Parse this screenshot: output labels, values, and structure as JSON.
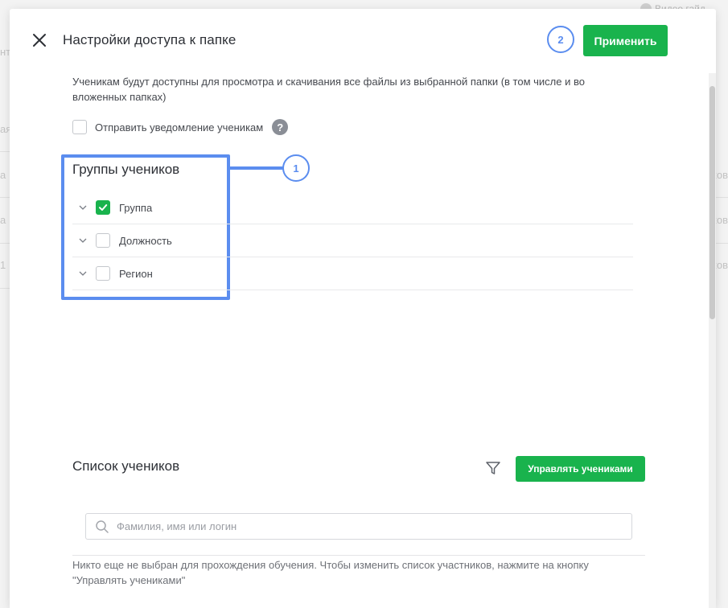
{
  "background": {
    "top_link": "Видео гайд",
    "left_fragments": [
      "нт",
      "ая",
      "а",
      "а",
      "1"
    ],
    "right_fragments": [
      "ков",
      "ков",
      "ков"
    ]
  },
  "modal": {
    "title": "Настройки доступа к папке",
    "apply_label": "Применить",
    "callout_apply": "2",
    "description": "Ученикам будут доступны для просмотра и скачивания все файлы из выбранной папки (в том числе и во вложенных папках)",
    "notify_label": "Отправить уведомление ученикам",
    "notify_checked": false,
    "help_glyph": "?"
  },
  "groups": {
    "title": "Группы учеников",
    "callout": "1",
    "items": [
      {
        "label": "Группа",
        "checked": true
      },
      {
        "label": "Должность",
        "checked": false
      },
      {
        "label": "Регион",
        "checked": false
      }
    ]
  },
  "students": {
    "title": "Список учеников",
    "manage_label": "Управлять учениками",
    "search_placeholder": "Фамилия, имя или логин",
    "empty_note": "Никто еще не выбран для прохождения обучения. Чтобы изменить список участников, нажмите на кнопку \"Управлять учениками\""
  },
  "colors": {
    "accent_green": "#19b34d",
    "callout_blue": "#5b8def"
  },
  "icons": [
    "close-icon",
    "help-icon",
    "chevron-down-icon",
    "check-icon",
    "filter-icon",
    "search-icon"
  ]
}
